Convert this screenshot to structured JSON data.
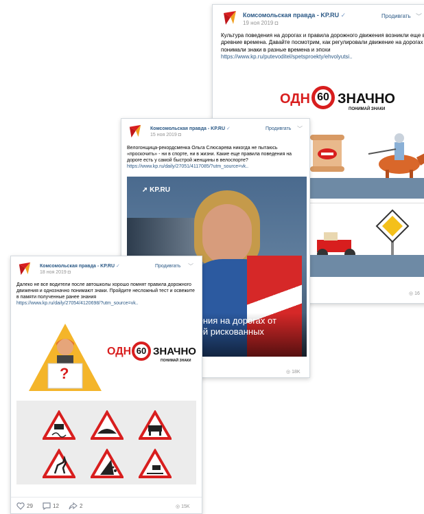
{
  "posts": [
    {
      "publisher": "Комсомольская правда - KP.RU",
      "check": "✓",
      "date": "19 ноя 2019",
      "subscribe": "Продивгать",
      "text": "Культура поведения на дорогах и правила дорожного движения возникли еще в древние времена. Давайте посмотрим, как регулировали движение на дорогах и понимали знаки в разные времена и эпохи",
      "link": "https://www.kp.ru/putevoditel/spetsproekty/ehvolyutsi..",
      "views": "16",
      "promo": {
        "left": "ОДН",
        "number": "60",
        "right": "ЗНАЧНО",
        "sub": "ПОНИМАЙ ЗНАКИ"
      }
    },
    {
      "publisher": "Комсомольская правда - KP.RU",
      "check": "✓",
      "date": "15 ноя 2019",
      "subscribe": "Продивгать",
      "text": "Велогонщица-рекордсменка Ольга Слюсарева никогда не пытаюсь «проскочить» - ни в спорте, ни в жизни. Какие еще правила поведения на дороге есть у самой быстрой женщины в велоспорте?",
      "link": "https://www.kp.ru/daily/27051/4117085/?utm_source=vk..",
      "views": "18K",
      "photo_brand": "KP.RU",
      "caption_line1": "дения на дорогах от",
      "caption_line2": "дей рискованных"
    },
    {
      "publisher": "Комсомольская правда - KP.RU",
      "check": "✓",
      "date": "18 ноя 2019",
      "subscribe": "Продивгать",
      "text": "Далеко не все водители после автошколы хорошо помнят правила дорожного движения и однозначно понимают знаки. Пройдите несложный тест и освежите в памяти полученные ранее знания",
      "link": "https://www.kp.ru/daily/27054/4120698/?utm_source=vk..",
      "views": "15K",
      "likes": "29",
      "comments": "12",
      "shares": "2",
      "promo": {
        "left": "ОДН",
        "number": "60",
        "right": "ЗНАЧНО",
        "sub": "ПОНИМАЙ ЗНАКИ"
      },
      "question_mark": "?"
    }
  ],
  "colors": {
    "link": "#2a5885",
    "kp_red": "#d81e1e",
    "meta": "#939393",
    "warning_yellow": "#f4b52a"
  }
}
